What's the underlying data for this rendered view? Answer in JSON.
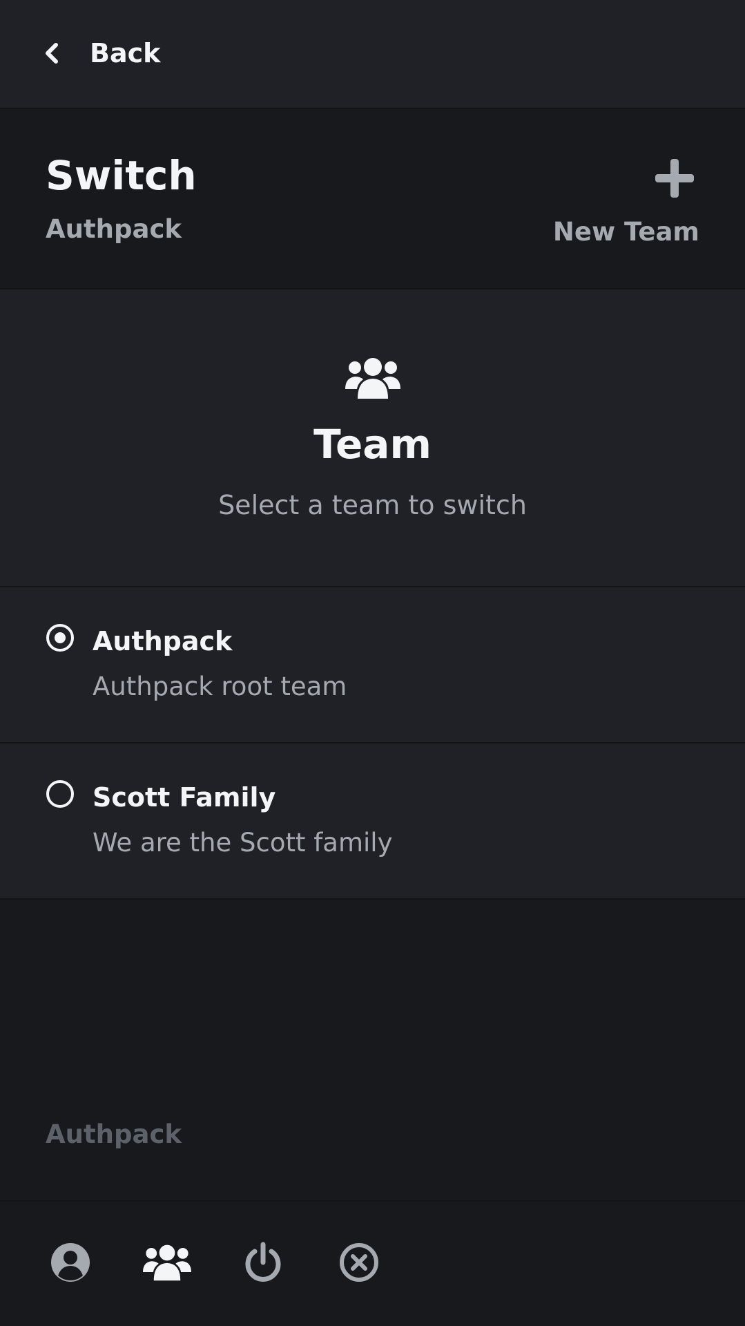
{
  "topbar": {
    "back_label": "Back"
  },
  "header": {
    "title": "Switch",
    "subtitle": "Authpack",
    "new_team_label": "New Team"
  },
  "hero": {
    "title": "Team",
    "subtitle": "Select a team to switch"
  },
  "teams": [
    {
      "name": "Authpack",
      "description": "Authpack root team",
      "selected": true
    },
    {
      "name": "Scott Family",
      "description": "We are the Scott family",
      "selected": false
    }
  ],
  "footer": {
    "brand": "Authpack"
  },
  "bottom_nav": [
    {
      "icon": "user-circle-icon"
    },
    {
      "icon": "users-icon"
    },
    {
      "icon": "power-icon"
    },
    {
      "icon": "close-circle-icon"
    }
  ],
  "colors": {
    "background": "#17191c",
    "surface": "#1f2126",
    "text": "#f4f5f7",
    "muted": "#a5a9b0",
    "faint": "#5d626a"
  }
}
